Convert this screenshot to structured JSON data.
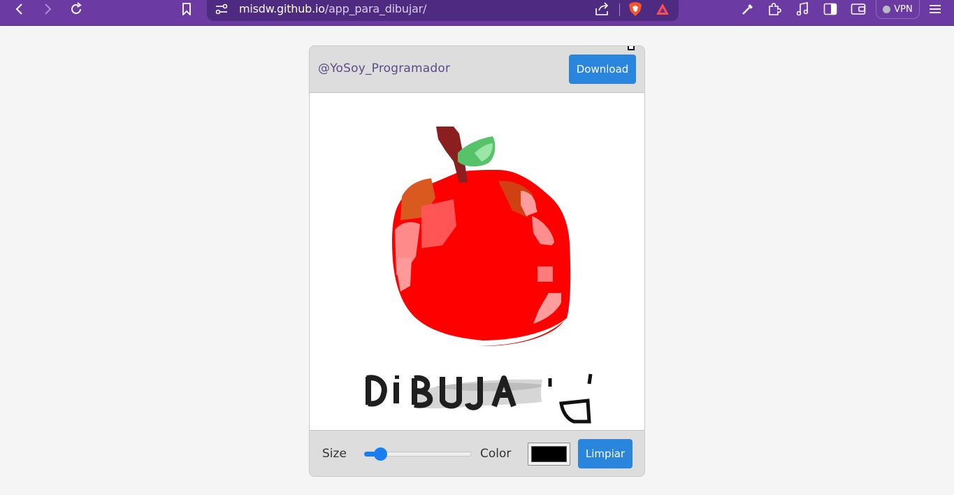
{
  "browser": {
    "url_host": "misdw.github.io",
    "url_path": "/app_para_dibujar/",
    "vpn_label": "VPN",
    "toolbar_color": "#6b3ba3"
  },
  "app": {
    "brand": "@YoSoy_Programador",
    "download_label": "Download",
    "size_label": "Size",
    "size_value_percent": 10,
    "color_label": "Color",
    "color_value": "#000000",
    "clear_label": "Limpiar",
    "accent_color": "#2a86dc"
  },
  "drawing": {
    "text": "DIBUJA",
    "subject": "apple"
  }
}
